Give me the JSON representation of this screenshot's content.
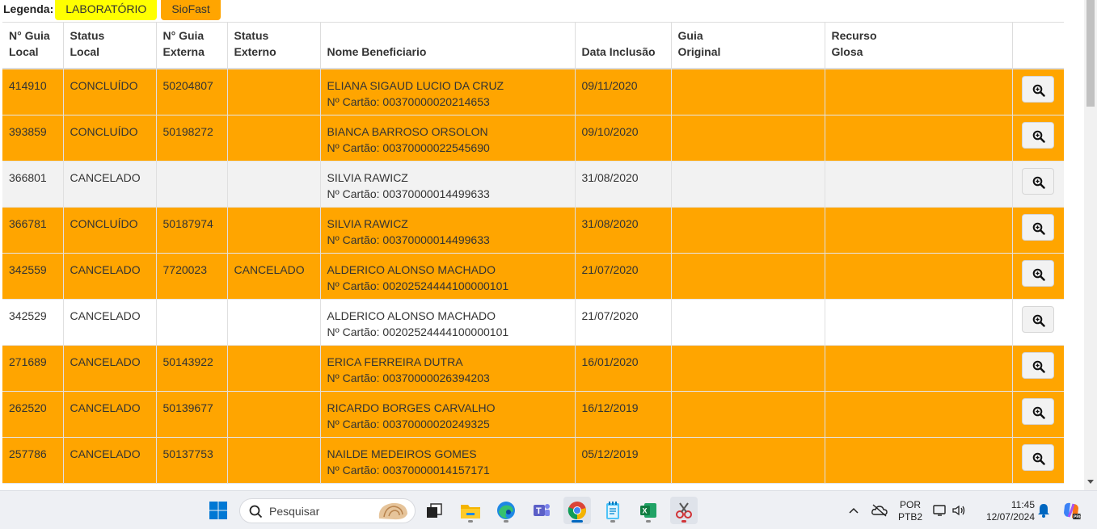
{
  "legend": {
    "label": "Legenda:",
    "items": [
      {
        "label": "LABORATÓRIO",
        "color": "#ffff00"
      },
      {
        "label": "SioFast",
        "color": "#ffa500"
      }
    ]
  },
  "table": {
    "headers": {
      "guia_local": [
        "N° Guia",
        "Local"
      ],
      "status_local": [
        "Status",
        "Local"
      ],
      "guia_externa": [
        "N° Guia",
        "Externa"
      ],
      "status_externo": [
        "Status",
        "Externo"
      ],
      "nome": "Nome Beneficiario",
      "data": "Data Inclusão",
      "guia_original": [
        "Guia",
        "Original"
      ],
      "recurso": [
        "Recurso",
        "Glosa"
      ]
    },
    "rows": [
      {
        "guia_local": "414910",
        "status_local": "CONCLUÍDO",
        "guia_externa": "50204807",
        "status_externo": "",
        "nome": "ELIANA SIGAUD LUCIO DA CRUZ",
        "cartao": "Nº Cartão: 00370000020214653",
        "data": "09/11/2020",
        "guia_original": "",
        "recurso": "",
        "row_color": "orange"
      },
      {
        "guia_local": "393859",
        "status_local": "CONCLUÍDO",
        "guia_externa": "50198272",
        "status_externo": "",
        "nome": "BIANCA BARROSO ORSOLON",
        "cartao": "Nº Cartão: 00370000022545690",
        "data": "09/10/2020",
        "guia_original": "",
        "recurso": "",
        "row_color": "orange"
      },
      {
        "guia_local": "366801",
        "status_local": "CANCELADO",
        "guia_externa": "",
        "status_externo": "",
        "nome": "SILVIA RAWICZ",
        "cartao": "Nº Cartão: 00370000014499633",
        "data": "31/08/2020",
        "guia_original": "",
        "recurso": "",
        "row_color": "grey"
      },
      {
        "guia_local": "366781",
        "status_local": "CONCLUÍDO",
        "guia_externa": "50187974",
        "status_externo": "",
        "nome": "SILVIA RAWICZ",
        "cartao": "Nº Cartão: 00370000014499633",
        "data": "31/08/2020",
        "guia_original": "",
        "recurso": "",
        "row_color": "orange"
      },
      {
        "guia_local": "342559",
        "status_local": "CANCELADO",
        "guia_externa": "7720023",
        "status_externo": "CANCELADO",
        "nome": "ALDERICO ALONSO MACHADO",
        "cartao": "Nº Cartão: 00202524444100000101",
        "data": "21/07/2020",
        "guia_original": "",
        "recurso": "",
        "row_color": "orange"
      },
      {
        "guia_local": "342529",
        "status_local": "CANCELADO",
        "guia_externa": "",
        "status_externo": "",
        "nome": "ALDERICO ALONSO MACHADO",
        "cartao": "Nº Cartão: 00202524444100000101",
        "data": "21/07/2020",
        "guia_original": "",
        "recurso": "",
        "row_color": "white"
      },
      {
        "guia_local": "271689",
        "status_local": "CANCELADO",
        "guia_externa": "50143922",
        "status_externo": "",
        "nome": "ERICA FERREIRA DUTRA",
        "cartao": "Nº Cartão: 00370000026394203",
        "data": "16/01/2020",
        "guia_original": "",
        "recurso": "",
        "row_color": "orange"
      },
      {
        "guia_local": "262520",
        "status_local": "CANCELADO",
        "guia_externa": "50139677",
        "status_externo": "",
        "nome": "RICARDO BORGES CARVALHO",
        "cartao": "Nº Cartão: 00370000020249325",
        "data": "16/12/2019",
        "guia_original": "",
        "recurso": "",
        "row_color": "orange"
      },
      {
        "guia_local": "257786",
        "status_local": "CANCELADO",
        "guia_externa": "50137753",
        "status_externo": "",
        "nome": "NAILDE MEDEIROS GOMES",
        "cartao": "Nº Cartão: 00370000014157171",
        "data": "05/12/2019",
        "guia_original": "",
        "recurso": "",
        "row_color": "orange"
      },
      {
        "guia_local": "",
        "status_local": "",
        "guia_externa": "",
        "status_externo": "",
        "nome": "",
        "cartao": "",
        "data": "",
        "guia_original": "",
        "recurso": "",
        "row_color": "white"
      }
    ],
    "action_icon": "zoom-in-icon"
  },
  "taskbar": {
    "search_placeholder": "Pesquisar",
    "apps": [
      "windows-start-icon",
      "task-view-icon",
      "file-explorer-icon",
      "edge-icon",
      "teams-icon",
      "chrome-icon",
      "notepad-icon",
      "excel-icon",
      "snipping-tool-icon"
    ],
    "language_line1": "POR",
    "language_line2": "PTB2",
    "time": "11:45",
    "date": "12/07/2024"
  }
}
